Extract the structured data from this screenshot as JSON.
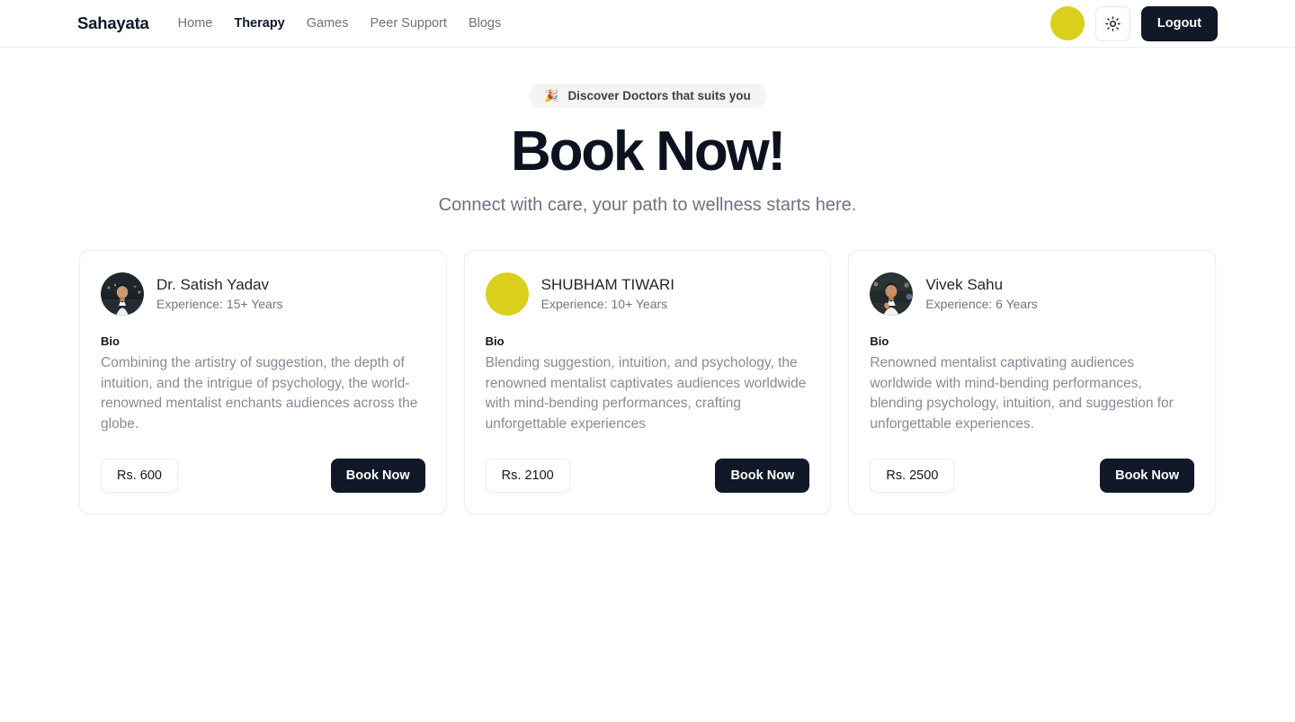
{
  "header": {
    "brand": "Sahayata",
    "nav": [
      {
        "label": "Home",
        "active": false
      },
      {
        "label": "Therapy",
        "active": true
      },
      {
        "label": "Games",
        "active": false
      },
      {
        "label": "Peer Support",
        "active": false
      },
      {
        "label": "Blogs",
        "active": false
      }
    ],
    "avatar_color": "#d9cf1c",
    "theme_icon": "sun-icon",
    "logout_label": "Logout"
  },
  "hero": {
    "badge_emoji": "🎉",
    "badge_text": "Discover Doctors that suits you",
    "title": "Book Now!",
    "subtitle": "Connect with care, your path to wellness starts here."
  },
  "cards": {
    "bio_label": "Bio",
    "items": [
      {
        "name": "Dr. Satish Yadav",
        "experience": "Experience: 15+ Years",
        "avatar_type": "photo-dark",
        "bio": "Combining the artistry of suggestion, the depth of intuition, and the intrigue of psychology, the world-renowned mentalist enchants audiences across the globe.",
        "price_label": "Rs. 600",
        "book_label": "Book Now"
      },
      {
        "name": "SHUBHAM TIWARI",
        "experience": "Experience: 10+ Years",
        "avatar_type": "solid-yellow",
        "bio": "Blending suggestion, intuition, and psychology, the renowned mentalist captivates audiences worldwide with mind-bending performances, crafting unforgettable experiences",
        "price_label": "Rs. 2100",
        "book_label": "Book Now"
      },
      {
        "name": "Vivek Sahu",
        "experience": "Experience: 6 Years",
        "avatar_type": "photo-light",
        "bio": "Renowned mentalist captivating audiences worldwide with mind-bending performances, blending psychology, intuition, and suggestion for unforgettable experiences.",
        "price_label": "Rs. 2500",
        "book_label": "Book Now"
      }
    ]
  }
}
